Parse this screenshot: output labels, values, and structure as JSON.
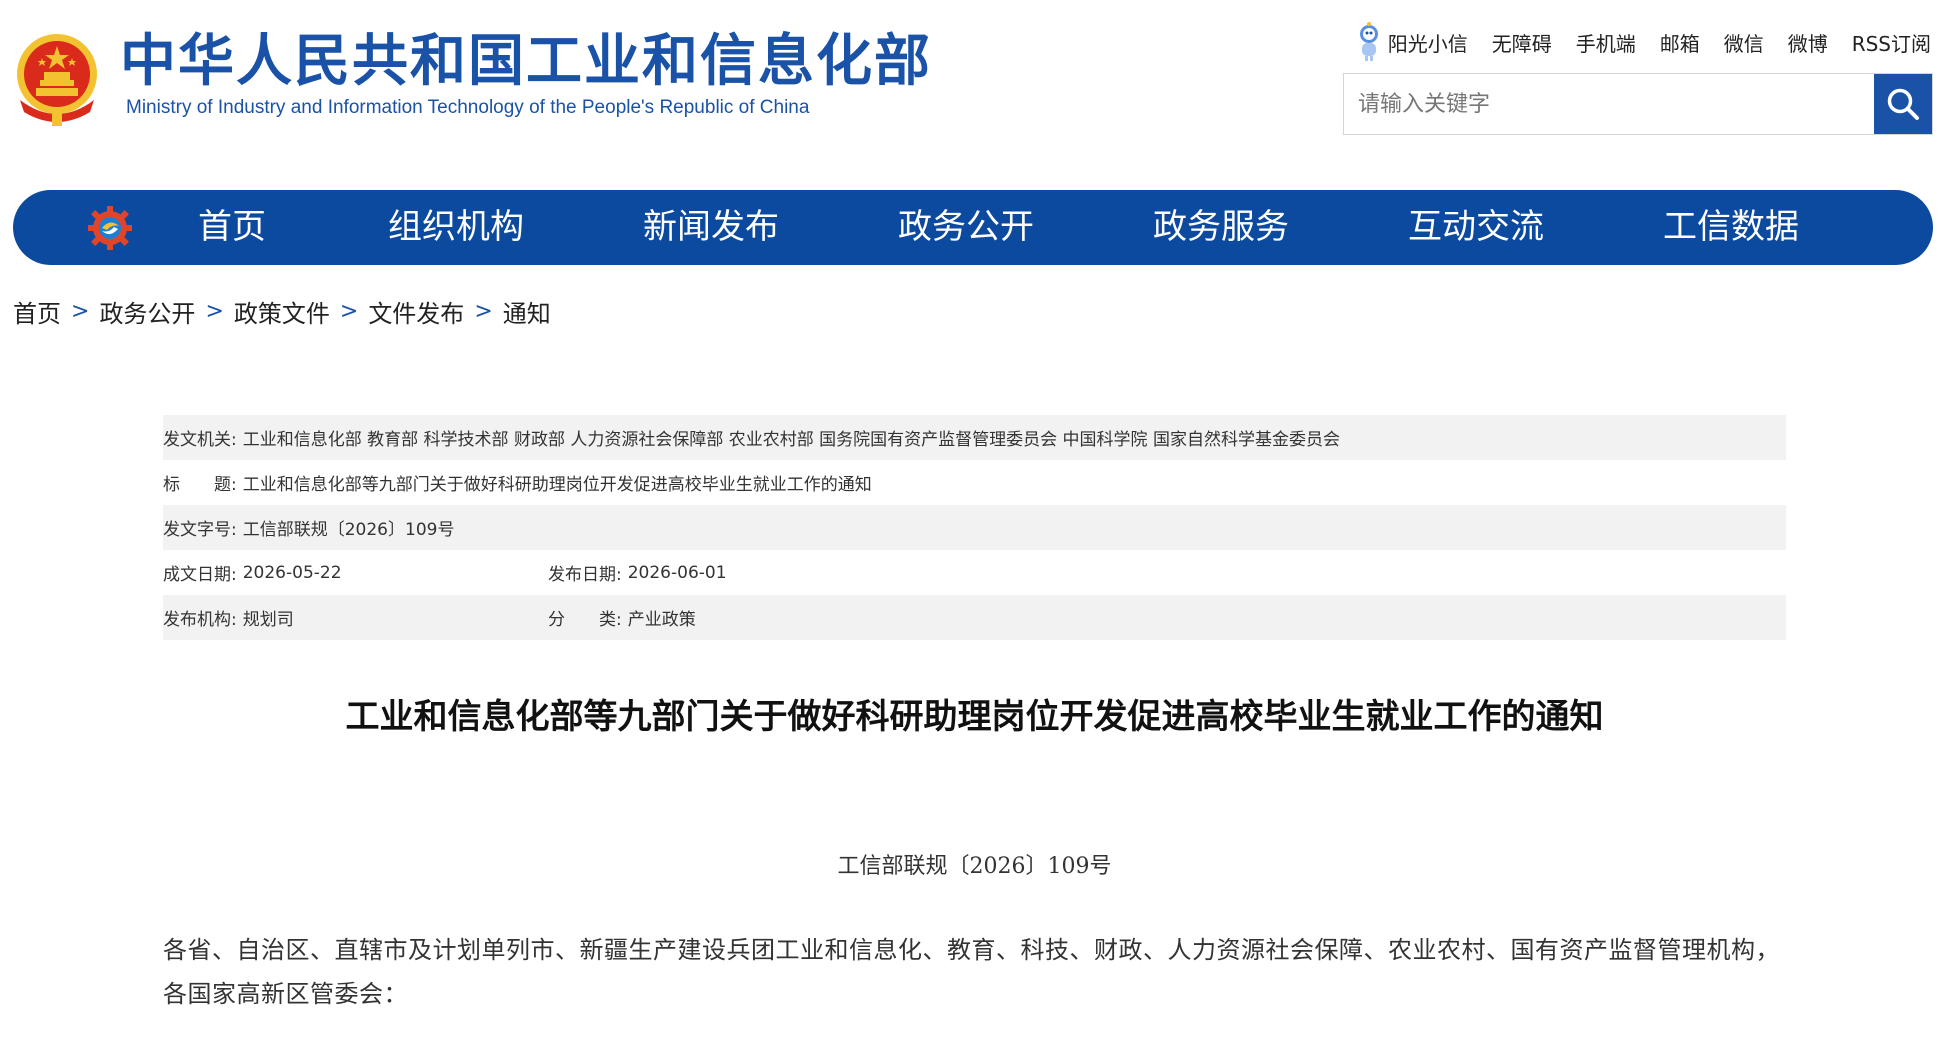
{
  "header": {
    "title_cn": "中华人民共和国工业和信息化部",
    "title_en": "Ministry of Industry and Information Technology of the People's Republic of China",
    "top_links": {
      "xiaoxin": "阳光小信",
      "accessibility": "无障碍",
      "mobile": "手机端",
      "mail": "邮箱",
      "wechat": "微信",
      "weibo": "微博",
      "rss": "RSS订阅"
    },
    "search": {
      "placeholder": "请输入关键字"
    }
  },
  "nav": {
    "items": [
      "首页",
      "组织机构",
      "新闻发布",
      "政务公开",
      "政务服务",
      "互动交流",
      "工信数据"
    ]
  },
  "breadcrumb": {
    "items": [
      "首页",
      "政务公开",
      "政策文件",
      "文件发布",
      "通知"
    ],
    "separator": ">"
  },
  "meta": {
    "issuer_label": "发文机关:",
    "issuer_value": "工业和信息化部 教育部 科学技术部 财政部 人力资源社会保障部 农业农村部 国务院国有资产监督管理委员会 中国科学院 国家自然科学基金委员会",
    "title_label": "标　　题:",
    "title_value": "工业和信息化部等九部门关于做好科研助理岗位开发促进高校毕业生就业工作的通知",
    "docno_label": "发文字号:",
    "docno_value": "工信部联规〔2026〕109号",
    "written_label": "成文日期:",
    "written_value": "2026-05-22",
    "published_label": "发布日期:",
    "published_value": "2026-06-01",
    "agency_label": "发布机构:",
    "agency_value": "规划司",
    "category_label": "分　　类:",
    "category_value": "产业政策"
  },
  "article": {
    "title": "工业和信息化部等九部门关于做好科研助理岗位开发促进高校毕业生就业工作的通知",
    "doc_number": "工信部联规〔2026〕109号",
    "body": "各省、自治区、直辖市及计划单列市、新疆生产建设兵团工业和信息化、教育、科技、财政、人力资源社会保障、农业农村、国有资产监督管理机构，各国家高新区管委会："
  },
  "colors": {
    "brand_blue": "#1a52a8",
    "nav_blue": "#0c4aa0",
    "shade_row": "#f2f2f2"
  },
  "icons": {
    "emblem": "national-emblem-icon",
    "xiaoxin": "robot-mascot-icon",
    "search": "search-icon",
    "nav_logo": "gear-logo-icon"
  }
}
